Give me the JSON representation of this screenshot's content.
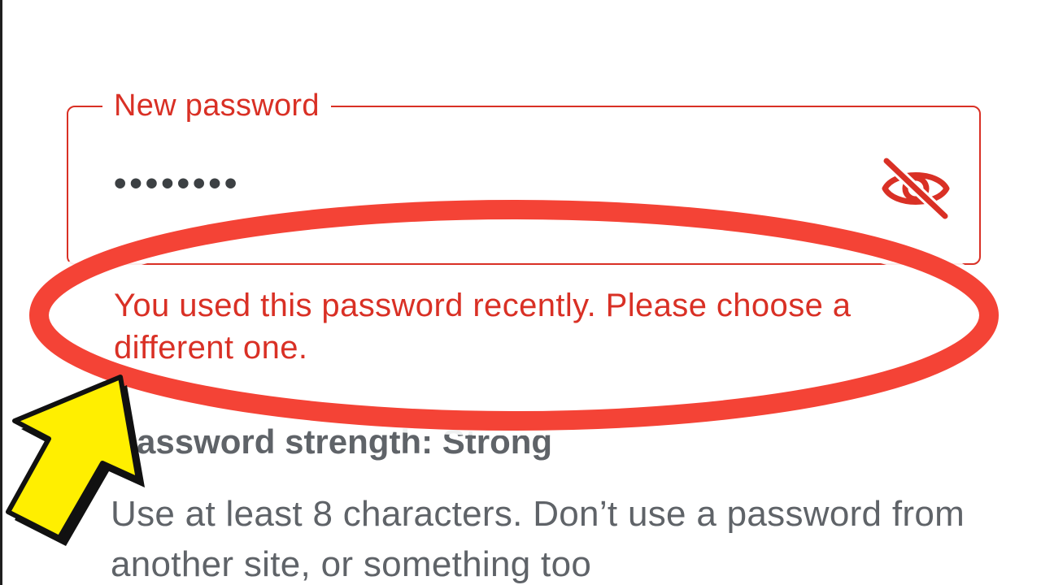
{
  "form": {
    "new_password_label": "New password",
    "new_password_value": "••••••••",
    "error_message": "You used this password recently. Please choose a different one.",
    "strength_text": "Password strength: Strong",
    "hint_text": "Use at least 8 characters. Don’t use a password from another site, or something too",
    "visibility_icon": "visibility-off-icon"
  },
  "annotation": {
    "highlight_ellipse_color": "#f44336",
    "arrow_color": "#ffef00",
    "arrow_outline_color": "#111111"
  },
  "colors": {
    "error": "#d93025",
    "secondary_text": "#5f6368",
    "input_text": "#3c4043",
    "background": "#ffffff"
  }
}
